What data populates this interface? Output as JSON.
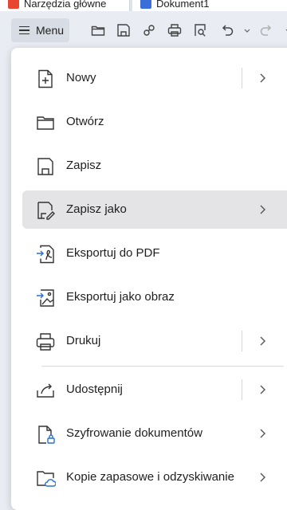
{
  "tabs": [
    {
      "label": "Narzędzia główne"
    },
    {
      "label": "Dokument1"
    }
  ],
  "toolbar": {
    "menu_label": "Menu",
    "icons": [
      "folder-open-icon",
      "save-icon",
      "export-share-icon",
      "print-icon",
      "print-preview-icon",
      "undo-icon",
      "redo-icon"
    ]
  },
  "menu": {
    "items": [
      {
        "label": "Nowy",
        "icon": "new-document-icon",
        "submenu": true,
        "split": true
      },
      {
        "label": "Otwórz",
        "icon": "folder-open-icon",
        "submenu": false
      },
      {
        "label": "Zapisz",
        "icon": "save-icon",
        "submenu": false
      },
      {
        "label": "Zapisz jako",
        "icon": "save-as-icon",
        "submenu": true,
        "split": false,
        "active": true
      },
      {
        "label": "Eksportuj do PDF",
        "icon": "export-pdf-icon",
        "submenu": false
      },
      {
        "label": "Eksportuj jako obraz",
        "icon": "export-image-icon",
        "submenu": false
      },
      {
        "label": "Drukuj",
        "icon": "print-icon",
        "submenu": true,
        "split": true
      },
      {
        "label": "Udostępnij",
        "icon": "share-icon",
        "submenu": true,
        "split": true
      },
      {
        "label": "Szyfrowanie dokumentów",
        "icon": "document-encryption-icon",
        "submenu": true,
        "split": false
      },
      {
        "label": "Kopie zapasowe i odzyskiwanie",
        "icon": "backup-recovery-icon",
        "submenu": true,
        "split": false
      }
    ]
  }
}
